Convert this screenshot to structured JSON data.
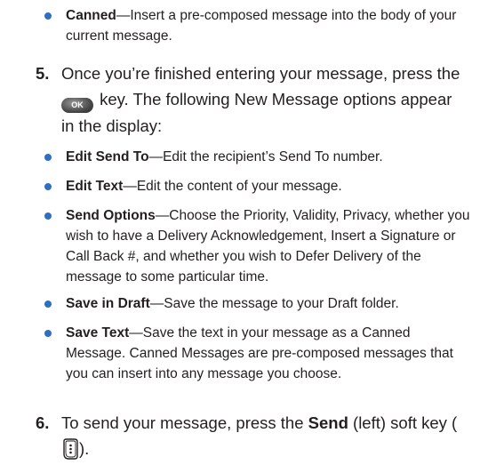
{
  "bullets_top": [
    {
      "title": "Canned",
      "desc": "—Insert a pre-composed message into the body of your current message."
    }
  ],
  "step5": {
    "number": "5.",
    "text_before_key": "Once you’re finished entering your message, press the",
    "key_label": "OK",
    "text_after_key": " key. The following New Message options appear in the display:"
  },
  "options": [
    {
      "title": "Edit Send To",
      "desc": "—Edit the recipient’s Send To number."
    },
    {
      "title": "Edit Text",
      "desc": "—Edit the content of your message."
    },
    {
      "title": "Send Options",
      "desc": "—Choose the Priority, Validity, Privacy, whether you wish to have a Delivery Acknowledgement, Insert a Signature or Call Back #, and whether you wish to Defer Delivery of the message to some particular time."
    },
    {
      "title": "Save in Draft",
      "desc": "—Save the message to your Draft folder."
    },
    {
      "title": "Save Text",
      "desc": "—Save the text in your message as a Canned Message. Canned Messages are pre-composed messages that you can insert into any message you choose."
    }
  ],
  "step6": {
    "number": "6.",
    "text_before": "To send your message, press the ",
    "send_word": "Send",
    "text_after": " (left) soft key (",
    "text_end": ")."
  },
  "colors": {
    "bullet": "#2f6fc0",
    "text": "#231f20"
  }
}
